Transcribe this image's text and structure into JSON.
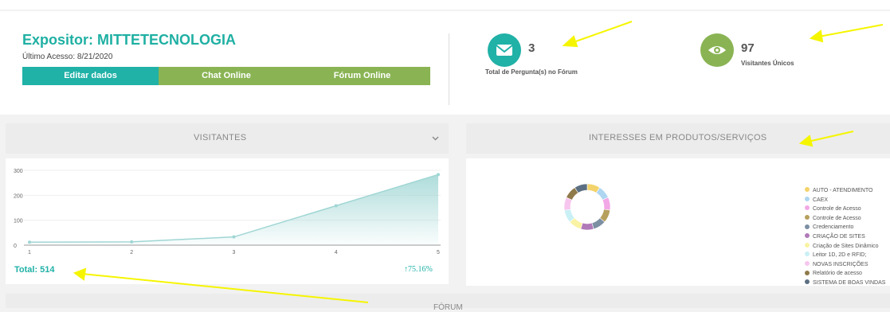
{
  "expositor": {
    "title": "Expositor: MITTETECNOLOGIA",
    "last_access": "Último Acesso: 8/21/2020",
    "buttons": {
      "edit": "Editar dados",
      "chat": "Chat Online",
      "forum": "Fórum Online"
    }
  },
  "stats": {
    "questions": {
      "value": "3",
      "label": "Total de Pergunta(s) no Fórum",
      "icon": "envelope-icon",
      "color": "#20b1a7"
    },
    "visitors": {
      "value": "97",
      "label": "Visitantes Únicos",
      "icon": "eye-icon",
      "color": "#8ab454"
    }
  },
  "panels": {
    "visitors": {
      "title": "VISITANTES",
      "total": "Total: 514",
      "growth": "75.16%",
      "growth_icon": "arrow-up-icon"
    },
    "interests": {
      "title": "INTERESSES EM PRODUTOS/SERVIÇOS"
    },
    "forum": {
      "title": "FÓRUM"
    }
  },
  "chart_data": [
    {
      "type": "area",
      "x": [
        1,
        2,
        3,
        4,
        5
      ],
      "values": [
        12,
        13,
        33,
        158,
        283
      ],
      "ylim": [
        0,
        300
      ],
      "yticks": [
        0,
        100,
        200,
        300
      ],
      "xticks": [
        1,
        2,
        3,
        4,
        5
      ],
      "color": "#9fd6d4"
    },
    {
      "type": "pie",
      "legend_position": "right",
      "labels": [
        "AUTO - ATENDIMENTO",
        "CAEX",
        "Controle de Acesso",
        "Controle de Acesso",
        "Credenciamento",
        "CRIAÇÃO DE SITES",
        "Criação de Sites Dinâmico",
        "Leitor 1D, 2D e RFID;",
        "NOVAS INSCRIÇÕES",
        "Relatório de acesso",
        "SISTEMA DE BOAS VINDAS"
      ],
      "values": [
        1,
        1,
        1,
        1,
        1,
        1,
        1,
        1,
        1,
        1,
        1
      ],
      "colors": [
        "#f3d36b",
        "#aed6f1",
        "#f2a7e6",
        "#b7a05e",
        "#7c8fa3",
        "#b07ab8",
        "#f9f3a3",
        "#c9f0f5",
        "#f7c6ee",
        "#8f7a4a",
        "#5c6f82"
      ]
    }
  ]
}
